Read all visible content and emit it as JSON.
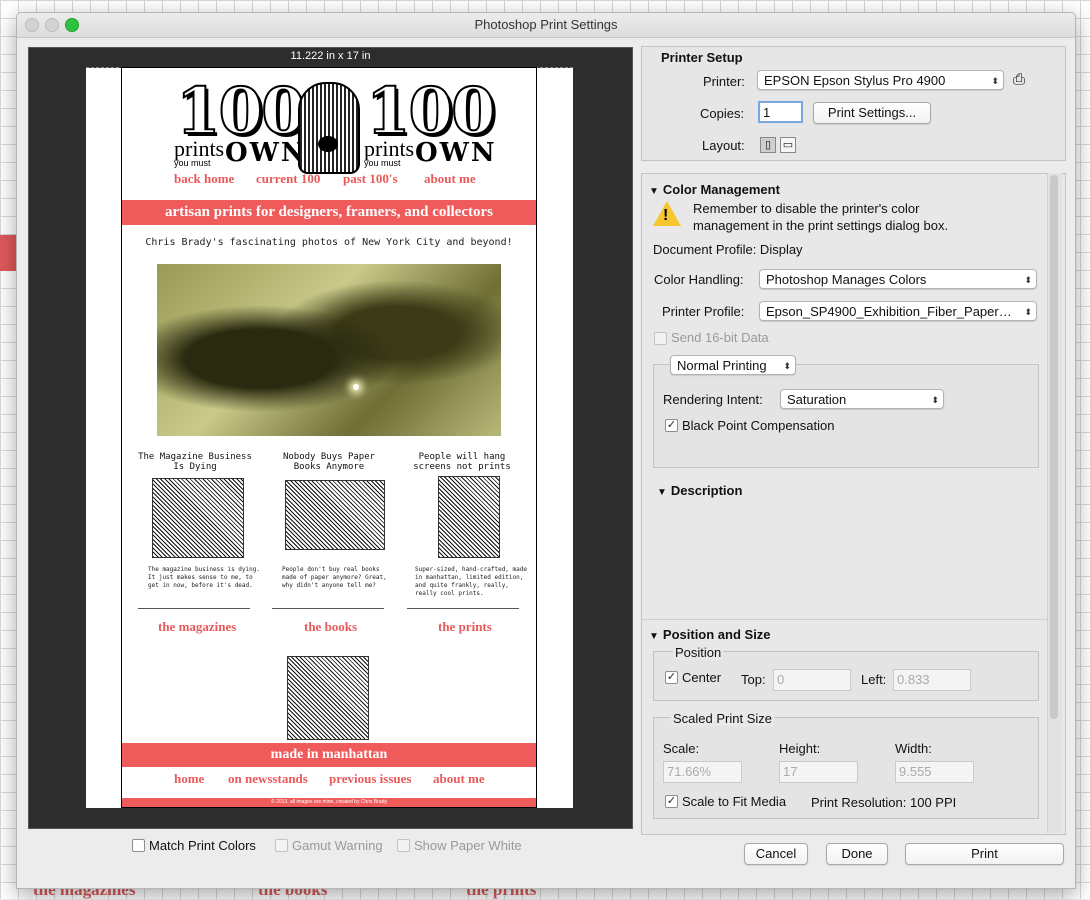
{
  "window": {
    "title": "Photoshop Print Settings"
  },
  "preview": {
    "size_label": "11.222 in x 17 in",
    "doc": {
      "mast_100": "100",
      "mast_prints": "prints",
      "mast_youmust": "you must",
      "mast_own": "OWN",
      "nav": [
        "back home",
        "current 100",
        "past 100's",
        "about me"
      ],
      "banner": "artisan prints for designers, framers, and collectors",
      "tagline": "Chris Brady's fascinating photos of New York City and beyond!",
      "columns": [
        {
          "title": "The Magazine Business Is Dying",
          "body": "The magazine business is dying. It just makes sense to me, to get in now, before it's dead.",
          "link": "the magazines"
        },
        {
          "title": "Nobody Buys Paper Books Anymore",
          "body": "People don't buy real books made of paper anymore? Great, why didn't anyone tell me?",
          "link": "the books"
        },
        {
          "title": "People will hang screens not prints",
          "body": "Super-sized, hand-crafted, made in manhattan, limited edition, and quite frankly, really, really cool prints.",
          "link": "the prints"
        }
      ],
      "made_in": "made in manhattan",
      "footer_nav": [
        "home",
        "on newsstands",
        "previous issues",
        "about me"
      ],
      "copyright": "© 2013, all images are mine, created by Chris Brady"
    }
  },
  "options": {
    "match_print_colors": "Match Print Colors",
    "gamut_warning": "Gamut Warning",
    "show_paper_white": "Show Paper White"
  },
  "printer_setup": {
    "heading": "Printer Setup",
    "printer_label": "Printer:",
    "printer_value": "EPSON Epson Stylus Pro 4900",
    "copies_label": "Copies:",
    "copies_value": "1",
    "print_settings_btn": "Print Settings...",
    "layout_label": "Layout:"
  },
  "color_management": {
    "heading": "Color Management",
    "warning_text": "Remember to disable the printer's color management in the print settings dialog box.",
    "doc_profile": "Document Profile: Display",
    "handling_label": "Color Handling:",
    "handling_value": "Photoshop Manages Colors",
    "profile_label": "Printer Profile:",
    "profile_value": "Epson_SP4900_Exhibition_Fiber_Paper…",
    "send16": "Send 16-bit Data",
    "mode_value": "Normal Printing",
    "intent_label": "Rendering Intent:",
    "intent_value": "Saturation",
    "bpc": "Black Point Compensation"
  },
  "description": {
    "heading": "Description"
  },
  "position_size": {
    "heading": "Position and Size",
    "position_label": "Position",
    "center": "Center",
    "top_label": "Top:",
    "top_value": "0",
    "left_label": "Left:",
    "left_value": "0.833",
    "scaled_label": "Scaled Print Size",
    "scale_label": "Scale:",
    "scale_value": "71.66%",
    "height_label": "Height:",
    "height_value": "17",
    "width_label": "Width:",
    "width_value": "9.555",
    "scale_to_fit": "Scale to Fit Media",
    "resolution": "Print Resolution: 100 PPI"
  },
  "buttons": {
    "cancel": "Cancel",
    "done": "Done",
    "print": "Print"
  },
  "background": {
    "links": [
      "the magazines",
      "the books",
      "the prints"
    ]
  },
  "colors": {
    "accent_red": "#ef5b5b",
    "warning_yellow": "#f6c630",
    "zoom_green": "#2fc241"
  }
}
